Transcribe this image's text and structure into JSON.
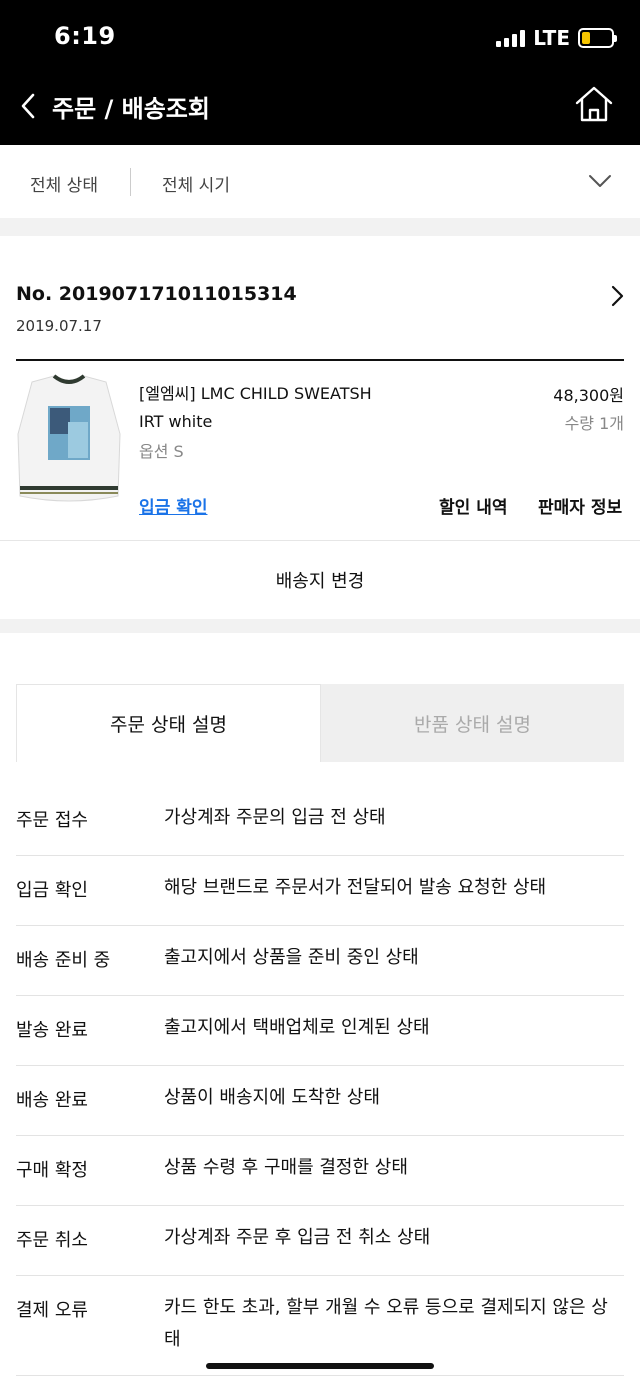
{
  "status_bar": {
    "time": "6:19",
    "network": "LTE",
    "battery_color": "#f5c400",
    "battery_level": 0.3
  },
  "header": {
    "title": "주문 / 배송조회",
    "back_icon": "back-arrow-icon",
    "home_icon": "home-icon",
    "background": "#000000"
  },
  "filters": {
    "status_label": "전체 상태",
    "period_label": "전체 시기"
  },
  "order": {
    "number": "No. 20190717101101531 4",
    "date": "2019.07.17",
    "product": {
      "name_line1": "[엘엠씨] LMC CHILD SWEATSH",
      "name_line2": "IRT white",
      "option": "옵션 S",
      "price": "48,300원",
      "quantity": "수량 1개",
      "status_link": "입금 확인",
      "discount_label": "할인 내역",
      "seller_label": "판매자 정보"
    },
    "change_address": "배송지 변경"
  },
  "tabs": [
    {
      "label": "주문 상태 설명",
      "active": true
    },
    {
      "label": "반품 상태 설명",
      "active": false
    }
  ],
  "statuses": [
    {
      "term": "주문 접수",
      "desc": "가상계좌 주문의 입금 전 상태"
    },
    {
      "term": "입금 확인",
      "desc": "해당 브랜드로 주문서가 전달되어 발송 요청한 상태"
    },
    {
      "term": "배송 준비 중",
      "desc": "출고지에서 상품을 준비 중인 상태"
    },
    {
      "term": "발송 완료",
      "desc": "출고지에서 택배업체로 인계된 상태"
    },
    {
      "term": "배송 완료",
      "desc": "상품이 배송지에 도착한 상태"
    },
    {
      "term": "구매 확정",
      "desc": "상품 수령 후 구매를 결정한 상태"
    },
    {
      "term": "주문 취소",
      "desc": "가상계좌 주문 후 입금 전 취소 상태"
    },
    {
      "term": "결제 오류",
      "desc": "카드 한도 초과, 할부 개월 수 오류 등으로 결제되지 않은 상태"
    }
  ],
  "colors": {
    "link": "#1a73e8",
    "muted": "#888888"
  }
}
